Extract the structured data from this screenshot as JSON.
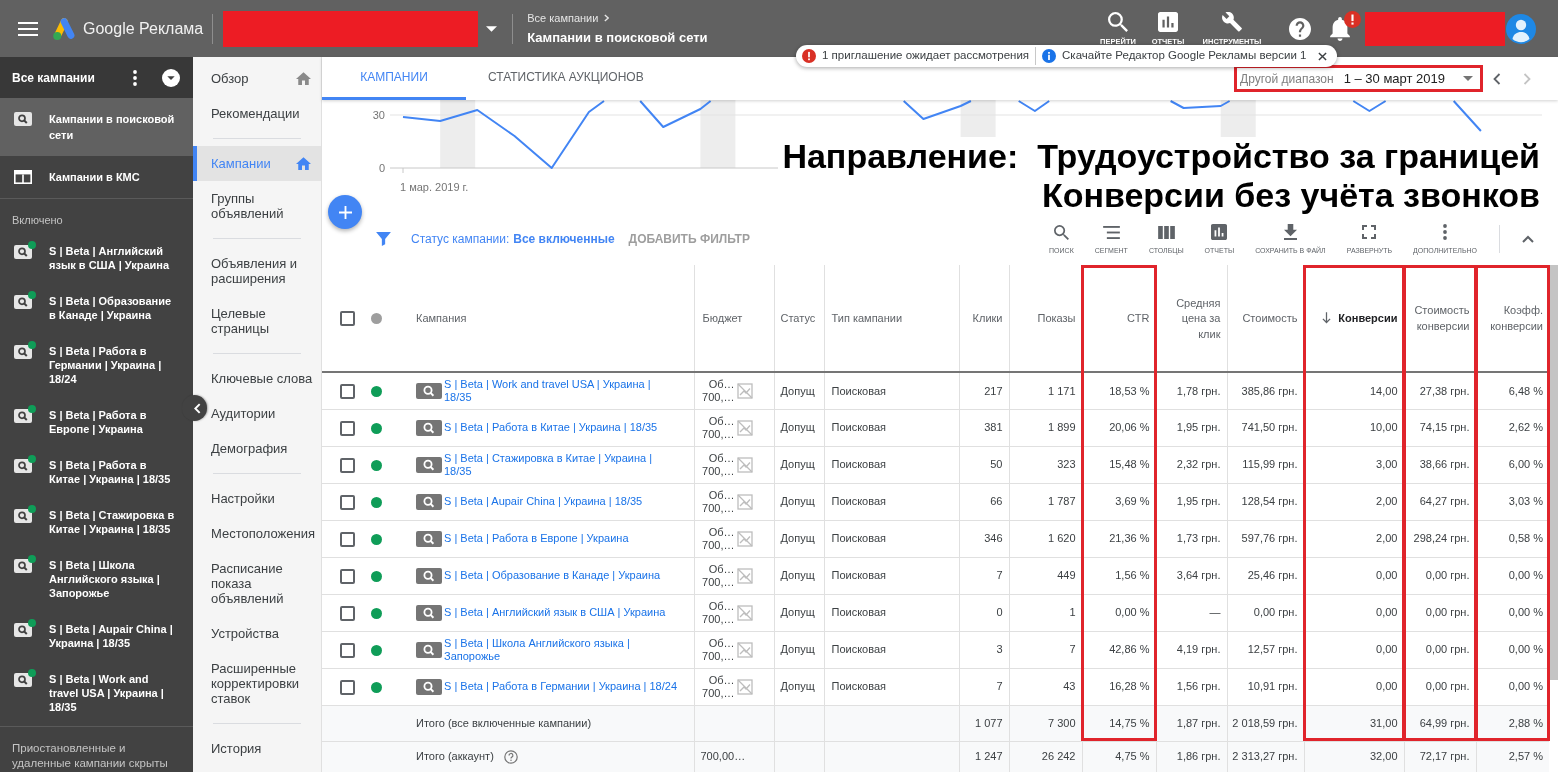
{
  "top_bar": {
    "product": "Google Реклама",
    "breadcrumb": {
      "parent": "Все кампании",
      "current": "Кампании в поисковой сети"
    },
    "tools": [
      {
        "kind": "search",
        "label": "ПЕРЕЙТИ"
      },
      {
        "kind": "reports",
        "label": "ОТЧЕТЫ"
      },
      {
        "kind": "tools",
        "label": "ИНСТРУМЕНТЫ"
      }
    ],
    "notifications_alert": true
  },
  "notices": [
    {
      "kind": "warning",
      "text": "1 приглашение ожидает рассмотрения"
    },
    {
      "kind": "info",
      "text": "Скачайте Редактор Google Рекламы версии 1"
    }
  ],
  "sidebar": {
    "title": "Все кампании",
    "views": [
      {
        "kind": "search",
        "label": "Кампании в поисковой сети",
        "selected": true
      },
      {
        "kind": "display",
        "label": "Кампании в КМС",
        "selected": false
      }
    ],
    "section": "Включено",
    "campaigns": [
      {
        "label": "S | Beta | Английский язык в США | Украина",
        "color": "#0f9d58"
      },
      {
        "label": "S | Beta | Образование в Канаде | Украина",
        "color": "#0f9d58"
      },
      {
        "label": "S | Beta | Работа в Германии | Украина | 18/24",
        "color": "#0f9d58"
      },
      {
        "label": "S | Beta | Работа в Европе | Украина",
        "color": "#0f9d58"
      },
      {
        "label": "S | Beta | Работа в Китае | Украина | 18/35",
        "color": "#0f9d58"
      },
      {
        "label": "S | Beta | Стажировка в Китае | Украина | 18/35",
        "color": "#0f9d58"
      },
      {
        "label": "S | Beta | Школа Английского языка | Запорожье",
        "color": "#0f9d58"
      },
      {
        "label": "S | Beta | Aupair China | Украина | 18/35",
        "color": "#0f9d58"
      },
      {
        "label": "S | Beta | Work and travel USA | Украина | 18/35",
        "color": "#0f9d58"
      }
    ],
    "note": "Приостановленные и удаленные кампании скрыты"
  },
  "nav": {
    "groups": [
      {
        "items": [
          {
            "label": "Обзор",
            "home": true,
            "selected": false
          },
          {
            "label": "Рекомендации",
            "home": false,
            "selected": false
          }
        ]
      },
      {
        "items": [
          {
            "label": "Кампании",
            "home": true,
            "selected": true
          },
          {
            "label": "Группы объявлений",
            "home": false,
            "selected": false
          }
        ]
      },
      {
        "items": [
          {
            "label": "Объявления и расширения",
            "home": false,
            "selected": false
          },
          {
            "label": "Целевые страницы",
            "home": false,
            "selected": false
          }
        ]
      },
      {
        "items": [
          {
            "label": "Ключевые слова",
            "home": false,
            "selected": false
          },
          {
            "label": "Аудитории",
            "home": false,
            "selected": false
          },
          {
            "label": "Демография",
            "home": false,
            "selected": false
          }
        ]
      },
      {
        "items": [
          {
            "label": "Настройки",
            "home": false,
            "selected": false
          },
          {
            "label": "Местоположения",
            "home": false,
            "selected": false
          },
          {
            "label": "Расписание показа объявлений",
            "home": false,
            "selected": false
          },
          {
            "label": "Устройства",
            "home": false,
            "selected": false
          },
          {
            "label": "Расширенные корректировки ставок",
            "home": false,
            "selected": false
          }
        ]
      },
      {
        "items": [
          {
            "label": "История",
            "home": false,
            "selected": false
          }
        ]
      }
    ]
  },
  "tabs": [
    {
      "label": "КАМПАНИИ",
      "selected": true
    },
    {
      "label": "СТАТИСТИКА АУКЦИОНОВ",
      "selected": false
    }
  ],
  "date_range": {
    "label": "Другой диапазон",
    "value": "1 – 30 март 2019",
    "highlighted": true
  },
  "chart": {
    "y_tick_labels": [
      "30",
      "0"
    ],
    "x_labels": [
      "1 мар. 2019 г."
    ]
  },
  "annotation": {
    "lines": [
      "Направление:  Трудоустройство за границей",
      "Конверсии без учёта звонков"
    ]
  },
  "filter": {
    "label": "Статус кампании:",
    "value": "Все включенные",
    "add_label": "ДОБАВИТЬ ФИЛЬТР"
  },
  "toolbar": [
    {
      "kind": "search",
      "label": "ПОИСК"
    },
    {
      "kind": "segment",
      "label": "СЕГМЕНТ"
    },
    {
      "kind": "columns",
      "label": "СТОЛБЦЫ"
    },
    {
      "kind": "reports",
      "label": "ОТЧЕТЫ"
    },
    {
      "kind": "download",
      "label": "СОХРАНИТЬ В ФАЙЛ"
    },
    {
      "kind": "expand",
      "label": "РАЗВЕРНУТЬ"
    },
    {
      "kind": "more",
      "label": "ДОПОЛНИТЕЛЬНО"
    }
  ],
  "table": {
    "header_checked": false,
    "columns": [
      {
        "label": "Кампания",
        "sorted": false,
        "highlighted": false
      },
      {
        "label": "Бюджет",
        "sorted": false,
        "highlighted": false
      },
      {
        "label": "Статус",
        "sorted": false,
        "highlighted": false
      },
      {
        "label": "Тип кампании",
        "sorted": false,
        "highlighted": false
      },
      {
        "label": "Клики",
        "sorted": false,
        "highlighted": false
      },
      {
        "label": "Показы",
        "sorted": false,
        "highlighted": false
      },
      {
        "label": "CTR",
        "sorted": false,
        "highlighted": true
      },
      {
        "label": "Средняя цена за клик",
        "sorted": false,
        "highlighted": false
      },
      {
        "label": "Стоимость",
        "sorted": false,
        "highlighted": false
      },
      {
        "label": "Конверсии",
        "sorted": true,
        "highlighted": true
      },
      {
        "label": "Стоимость конверсии",
        "sorted": false,
        "highlighted": true
      },
      {
        "label": "Коэфф. конверсии",
        "sorted": false,
        "highlighted": true
      }
    ],
    "rows": [
      {
        "checked": false,
        "color": "#0f9d58",
        "campaign": "S | Beta | Work and travel USA | Украина | 18/35",
        "budget": [
          "Об…",
          "700,…"
        ],
        "status": "Допущ",
        "type": "Поисковая",
        "values": [
          "217",
          "1 171",
          "18,53 %",
          "1,78 грн.",
          "385,86 грн.",
          "14,00",
          "27,38 грн.",
          "6,48 %"
        ]
      },
      {
        "checked": false,
        "color": "#0f9d58",
        "campaign": "S | Beta | Работа в Китае | Украина | 18/35",
        "budget": [
          "Об…",
          "700,…"
        ],
        "status": "Допущ",
        "type": "Поисковая",
        "values": [
          "381",
          "1 899",
          "20,06 %",
          "1,95 грн.",
          "741,50 грн.",
          "10,00",
          "74,15 грн.",
          "2,62 %"
        ]
      },
      {
        "checked": false,
        "color": "#0f9d58",
        "campaign": "S | Beta | Стажировка в Китае | Украина | 18/35",
        "budget": [
          "Об…",
          "700,…"
        ],
        "status": "Допущ",
        "type": "Поисковая",
        "values": [
          "50",
          "323",
          "15,48 %",
          "2,32 грн.",
          "115,99 грн.",
          "3,00",
          "38,66 грн.",
          "6,00 %"
        ]
      },
      {
        "checked": false,
        "color": "#0f9d58",
        "campaign": "S | Beta | Aupair China | Украина | 18/35",
        "budget": [
          "Об…",
          "700,…"
        ],
        "status": "Допущ",
        "type": "Поисковая",
        "values": [
          "66",
          "1 787",
          "3,69 %",
          "1,95 грн.",
          "128,54 грн.",
          "2,00",
          "64,27 грн.",
          "3,03 %"
        ]
      },
      {
        "checked": false,
        "color": "#0f9d58",
        "campaign": "S | Beta | Работа в Европе | Украина",
        "budget": [
          "Об…",
          "700,…"
        ],
        "status": "Допущ",
        "type": "Поисковая",
        "values": [
          "346",
          "1 620",
          "21,36 %",
          "1,73 грн.",
          "597,76 грн.",
          "2,00",
          "298,24 грн.",
          "0,58 %"
        ]
      },
      {
        "checked": false,
        "color": "#0f9d58",
        "campaign": "S | Beta | Образование в Канаде | Украина",
        "budget": [
          "Об…",
          "700,…"
        ],
        "status": "Допущ",
        "type": "Поисковая",
        "values": [
          "7",
          "449",
          "1,56 %",
          "3,64 грн.",
          "25,46 грн.",
          "0,00",
          "0,00 грн.",
          "0,00 %"
        ]
      },
      {
        "checked": false,
        "color": "#0f9d58",
        "campaign": "S | Beta | Английский язык в США | Украина",
        "budget": [
          "Об…",
          "700,…"
        ],
        "status": "Допущ",
        "type": "Поисковая",
        "values": [
          "0",
          "1",
          "0,00 %",
          "—",
          "0,00 грн.",
          "0,00",
          "0,00 грн.",
          "0,00 %"
        ]
      },
      {
        "checked": false,
        "color": "#0f9d58",
        "campaign": "S | Beta | Школа Английского языка | Запорожье",
        "budget": [
          "Об…",
          "700,…"
        ],
        "status": "Допущ",
        "type": "Поисковая",
        "values": [
          "3",
          "7",
          "42,86 %",
          "4,19 грн.",
          "12,57 грн.",
          "0,00",
          "0,00 грн.",
          "0,00 %"
        ]
      },
      {
        "checked": false,
        "color": "#0f9d58",
        "campaign": "S | Beta | Работа в Германии | Украина | 18/24",
        "budget": [
          "Об…",
          "700,…"
        ],
        "status": "Допущ",
        "type": "Поисковая",
        "values": [
          "7",
          "43",
          "16,28 %",
          "1,56 грн.",
          "10,91 грн.",
          "0,00",
          "0,00 грн.",
          "0,00 %"
        ]
      }
    ],
    "totals": [
      {
        "label": "Итого (все включенные кампании)",
        "help": false,
        "values": [
          "1 077",
          "7 300",
          "14,75 %",
          "1,87 грн.",
          "2 018,59 грн.",
          "31,00",
          "64,99 грн.",
          "2,88 %"
        ]
      },
      {
        "label": "Итого (аккаунт)",
        "help": true,
        "budget": "700,00…",
        "values": [
          "1 247",
          "26 242",
          "4,75 %",
          "1,86 грн.",
          "2 313,27 грн.",
          "32,00",
          "72,17 грн.",
          "2,57 %"
        ]
      }
    ]
  }
}
